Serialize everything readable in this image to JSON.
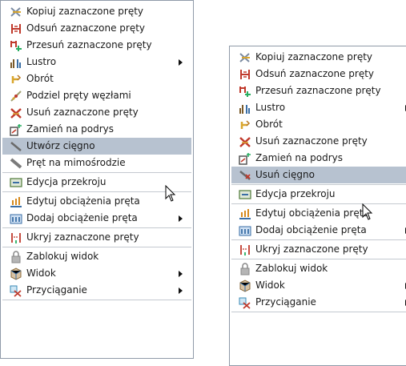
{
  "left_menu": {
    "items": [
      {
        "label": "Kopiuj zaznaczone pręty",
        "icon": "copy-bars-icon"
      },
      {
        "label": "Odsuń zaznaczone pręty",
        "icon": "offset-bars-icon"
      },
      {
        "label": "Przesuń zaznaczone pręty",
        "icon": "move-bars-icon"
      },
      {
        "label": "Lustro",
        "icon": "mirror-icon"
      },
      {
        "label": "Obrót",
        "icon": "rotate-icon"
      },
      {
        "label": "Podziel pręty węzłami",
        "icon": "divide-icon"
      },
      {
        "label": "Usuń zaznaczone pręty",
        "icon": "delete-bars-icon"
      },
      {
        "label": "Zamień na podrys",
        "icon": "underlay-icon"
      },
      {
        "label": "Utwórz cięgno",
        "icon": "tendon-icon"
      },
      {
        "label": "Pręt na mimośrodzie",
        "icon": "eccentric-bar-icon"
      },
      {
        "label": "Edycja przekroju",
        "icon": "section-icon"
      },
      {
        "label": "Edytuj obciążenia pręta",
        "icon": "edit-loads-icon"
      },
      {
        "label": "Dodaj obciążenie pręta",
        "icon": "add-load-icon"
      },
      {
        "label": "Ukryj zaznaczone pręty",
        "icon": "hide-bars-icon"
      },
      {
        "label": "Zablokuj widok",
        "icon": "lock-icon"
      },
      {
        "label": "Widok",
        "icon": "view-icon"
      },
      {
        "label": "Przyciąganie",
        "icon": "snap-icon"
      }
    ]
  },
  "right_menu": {
    "items": [
      {
        "label": "Kopiuj zaznaczone pręty",
        "icon": "copy-bars-icon"
      },
      {
        "label": "Odsuń zaznaczone pręty",
        "icon": "offset-bars-icon"
      },
      {
        "label": "Przesuń zaznaczone pręty",
        "icon": "move-bars-icon"
      },
      {
        "label": "Lustro",
        "icon": "mirror-icon"
      },
      {
        "label": "Obrót",
        "icon": "rotate-icon"
      },
      {
        "label": "Usuń zaznaczone pręty",
        "icon": "delete-bars-icon"
      },
      {
        "label": "Zamień na podrys",
        "icon": "underlay-icon"
      },
      {
        "label": "Usuń cięgno",
        "icon": "delete-tendon-icon"
      },
      {
        "label": "Edycja przekroju",
        "icon": "section-icon"
      },
      {
        "label": "Edytuj obciążenia pręta",
        "icon": "edit-loads-icon"
      },
      {
        "label": "Dodaj obciążenie pręta",
        "icon": "add-load-icon"
      },
      {
        "label": "Ukryj zaznaczone pręty",
        "icon": "hide-bars-icon"
      },
      {
        "label": "Zablokuj widok",
        "icon": "lock-icon"
      },
      {
        "label": "Widok",
        "icon": "view-icon"
      },
      {
        "label": "Przyciąganie",
        "icon": "snap-icon"
      }
    ]
  },
  "colors": {
    "highlight": "#b7c2d0",
    "border": "#8f9aa8",
    "separator": "#c4c9d0"
  }
}
